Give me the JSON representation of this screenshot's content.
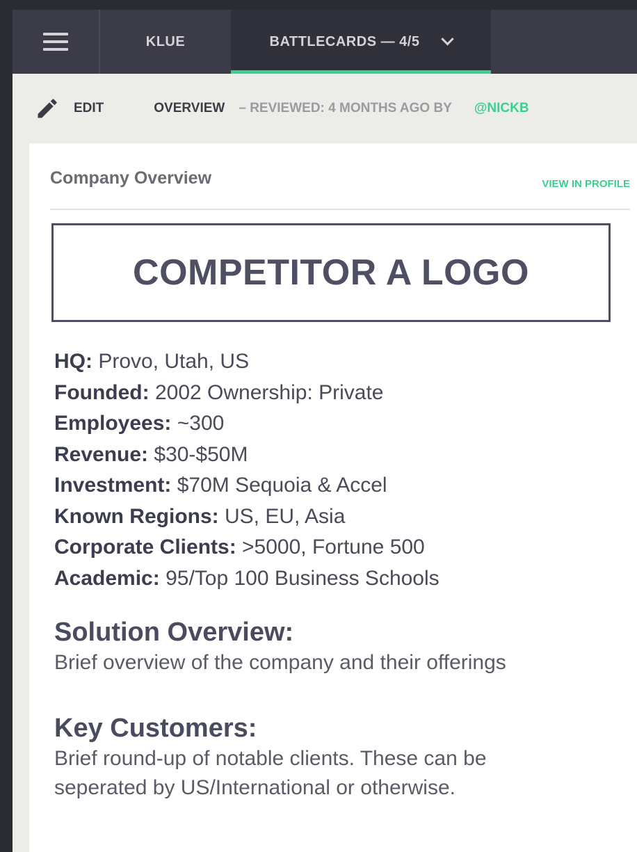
{
  "nav": {
    "tabs": [
      {
        "label": "KLUE"
      },
      {
        "label": "BATTLECARDS — 4/5"
      }
    ]
  },
  "subbar": {
    "edit_label": "EDIT",
    "section_label": "OVERVIEW",
    "reviewed_text": "– REVIEWED: 4 MONTHS AGO BY",
    "reviewer": "@NICKB"
  },
  "card": {
    "title": "Company Overview",
    "view_in_profile": "VIEW IN PROFILE",
    "logo_text": "COMPETITOR A LOGO",
    "facts": [
      {
        "key": "HQ:",
        "value": " Provo, Utah, US"
      },
      {
        "key": "Founded:",
        "value": " 2002 Ownership: Private"
      },
      {
        "key": "Employees:",
        "value": " ~300"
      },
      {
        "key": "Revenue:",
        "value": " $30-$50M"
      },
      {
        "key": "Investment:",
        "value": " $70M Sequoia & Accel"
      },
      {
        "key": "Known Regions:",
        "value": " US, EU, Asia"
      },
      {
        "key": "Corporate Clients:",
        "value": " >5000, Fortune 500"
      },
      {
        "key": "Academic:",
        "value": " 95/Top 100 Business Schools"
      }
    ],
    "solution": {
      "title": "Solution Overview:",
      "lines": [
        "Brief overview of the company and their offerings"
      ]
    },
    "customers": {
      "title": "Key Customers:",
      "lines": [
        "Brief round-up of notable clients. These can be",
        "seperated by US/International or otherwise."
      ]
    }
  },
  "colors": {
    "accent": "#3ecf8e",
    "nav_bg": "#3b3c47",
    "text_dark": "#3c3d4e"
  },
  "icons": {
    "menu": "hamburger-icon",
    "edit": "pencil-icon",
    "dropdown": "chevron-down-icon"
  }
}
